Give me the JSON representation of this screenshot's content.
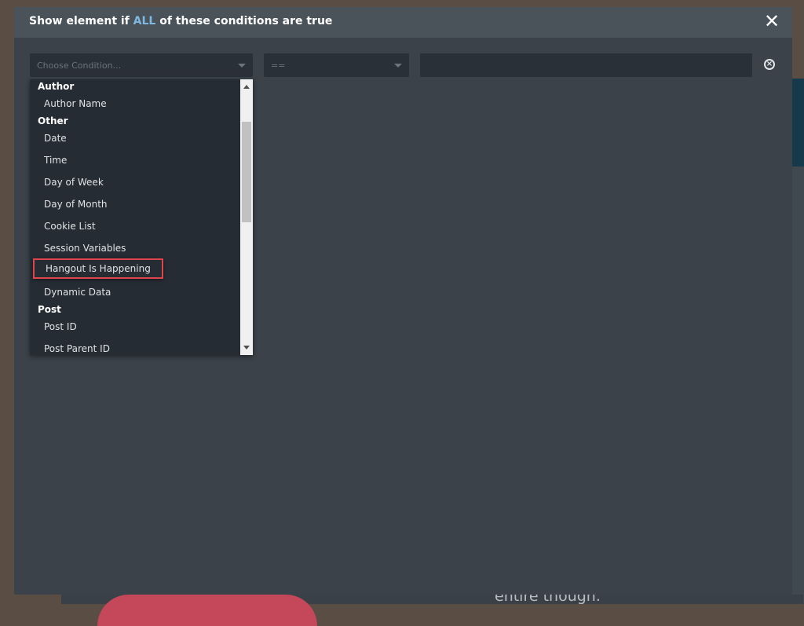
{
  "background": {
    "partial_text": "entire though."
  },
  "modal": {
    "title_before": "Show element if ",
    "title_accent": "ALL",
    "title_after": " of these conditions are true",
    "close_icon": "close-icon",
    "accent_color": "#7fb8e0"
  },
  "condition_row": {
    "condition_select": {
      "placeholder": "Choose Condition..."
    },
    "operator_select": {
      "value": "=="
    },
    "value_input": {
      "value": "",
      "placeholder": ""
    },
    "remove_icon": "circle-x-icon"
  },
  "dropdown": {
    "groups": [
      {
        "label": "Author",
        "options": [
          "Author Name"
        ]
      },
      {
        "label": "Other",
        "options": [
          "Date",
          "Time",
          "Day of Week",
          "Day of Month",
          "Cookie List",
          "Session Variables",
          "Hangout Is Happening",
          "Dynamic Data"
        ]
      },
      {
        "label": "Post",
        "options": [
          "Post ID",
          "Post Parent ID"
        ]
      }
    ],
    "highlighted_option": "Hangout Is Happening",
    "highlight_color": "#e0454b"
  }
}
